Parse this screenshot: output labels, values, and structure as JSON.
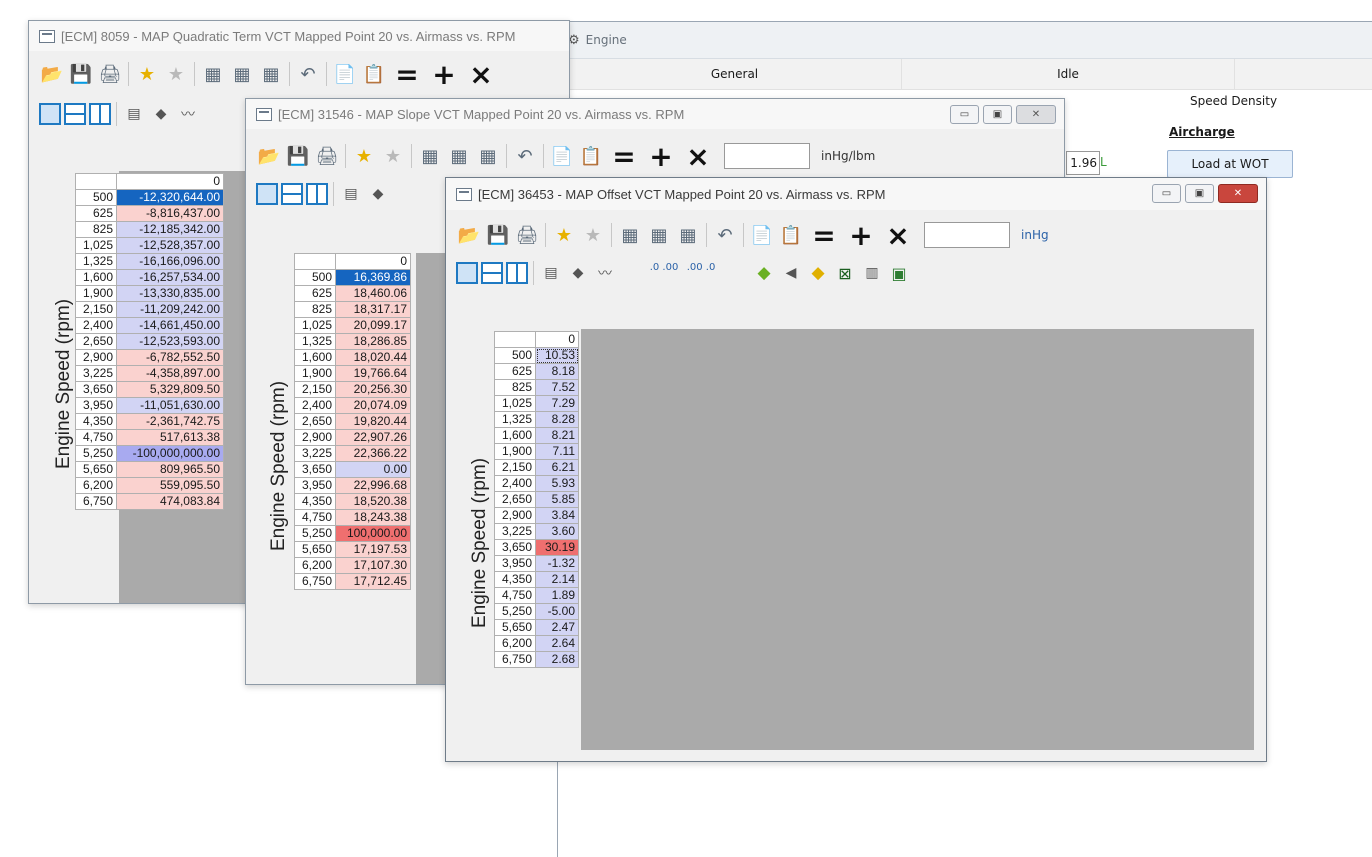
{
  "engine": {
    "title": "Engine",
    "tabs": [
      "General",
      "Idle"
    ],
    "subtab": "Speed Density",
    "aircharge_label": "Aircharge",
    "field_value": "1.96",
    "field_unit": "L",
    "load_button": "Load at WOT"
  },
  "win1": {
    "title": "[ECM] 8059 - MAP Quadratic Term VCT Mapped Point 20 vs. Airmass vs. RPM",
    "axis_label": "Engine Speed (rpm)",
    "col_header": "0",
    "rows": [
      "500",
      "625",
      "825",
      "1,025",
      "1,325",
      "1,600",
      "1,900",
      "2,150",
      "2,400",
      "2,650",
      "2,900",
      "3,225",
      "3,650",
      "3,950",
      "4,350",
      "4,750",
      "5,250",
      "5,650",
      "6,200",
      "6,750"
    ],
    "values": [
      "-12,320,644.00",
      "-8,816,437.00",
      "-12,185,342.00",
      "-12,528,357.00",
      "-16,166,096.00",
      "-16,257,534.00",
      "-13,330,835.00",
      "-11,209,242.00",
      "-14,661,450.00",
      "-12,523,593.00",
      "-6,782,552.50",
      "-4,358,897.00",
      "5,329,809.50",
      "-11,051,630.00",
      "-2,361,742.75",
      "517,613.38",
      "-100,000,000.00",
      "809,965.50",
      "559,095.50",
      "474,083.84"
    ]
  },
  "win2": {
    "title": "[ECM] 31546 - MAP Slope VCT Mapped Point 20 vs. Airmass vs. RPM",
    "unit": "inHg/lbm",
    "axis_label": "Engine Speed (rpm)",
    "col_header": "0",
    "rows": [
      "500",
      "625",
      "825",
      "1,025",
      "1,325",
      "1,600",
      "1,900",
      "2,150",
      "2,400",
      "2,650",
      "2,900",
      "3,225",
      "3,650",
      "3,950",
      "4,350",
      "4,750",
      "5,250",
      "5,650",
      "6,200",
      "6,750"
    ],
    "values": [
      "16,369.86",
      "18,460.06",
      "18,317.17",
      "20,099.17",
      "18,286.85",
      "18,020.44",
      "19,766.64",
      "20,256.30",
      "20,074.09",
      "19,820.44",
      "22,907.26",
      "22,366.22",
      "0.00",
      "22,996.68",
      "18,520.38",
      "18,243.38",
      "100,000.00",
      "17,197.53",
      "17,107.30",
      "17,712.45"
    ]
  },
  "win3": {
    "title": "[ECM] 36453 - MAP Offset VCT Mapped Point 20 vs. Airmass vs. RPM",
    "unit": "inHg",
    "axis_label": "Engine Speed (rpm)",
    "col_header": "0",
    "rows": [
      "500",
      "625",
      "825",
      "1,025",
      "1,325",
      "1,600",
      "1,900",
      "2,150",
      "2,400",
      "2,650",
      "2,900",
      "3,225",
      "3,650",
      "3,950",
      "4,350",
      "4,750",
      "5,250",
      "5,650",
      "6,200",
      "6,750"
    ],
    "values": [
      "10.53",
      "8.18",
      "7.52",
      "7.29",
      "8.28",
      "8.21",
      "7.11",
      "6.21",
      "5.93",
      "5.85",
      "3.84",
      "3.60",
      "30.19",
      "-1.32",
      "2.14",
      "1.89",
      "-5.00",
      "2.47",
      "2.64",
      "2.68"
    ],
    "decimals_up": ".0 .00",
    "decimals_down": ".00 .0"
  }
}
